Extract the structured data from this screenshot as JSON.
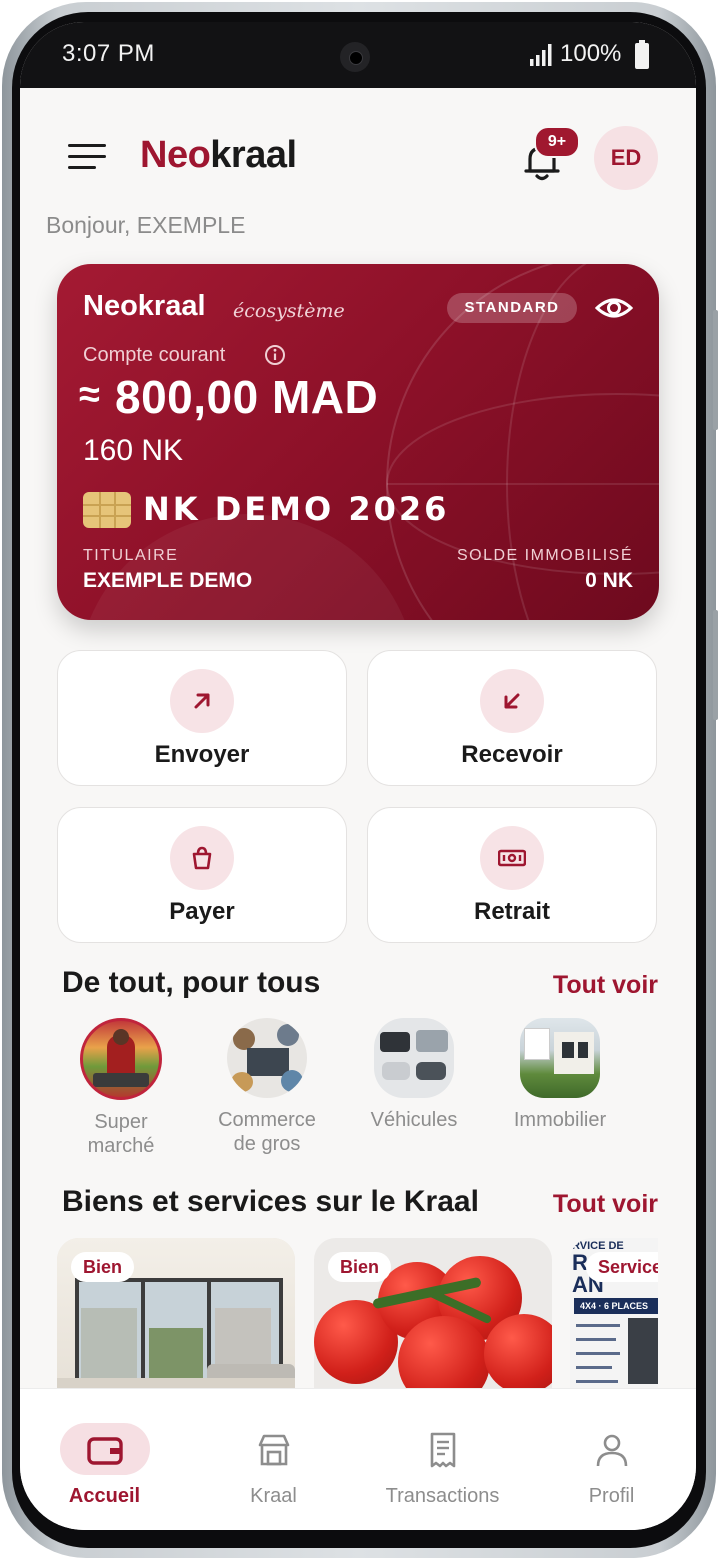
{
  "status_bar": {
    "time": "3:07 PM",
    "battery": "100%"
  },
  "header": {
    "logo_part1": "Neo",
    "logo_part2": "kraal",
    "notification_badge": "9+",
    "avatar_initials": "ED"
  },
  "greeting": "Bonjour, EXEMPLE",
  "card": {
    "brand": "Neokraal",
    "brand_sub": "écosystème",
    "tier": "STANDARD",
    "account_label": "Compte courant",
    "approx_symbol": "≈",
    "balance": "800,00 MAD",
    "nk_balance": "160 NK",
    "card_number": "NK DEMO 2026",
    "holder_label": "TITULAIRE",
    "holder_name": "EXEMPLE DEMO",
    "locked_label": "SOLDE IMMOBILISÉ",
    "locked_value": "0 NK"
  },
  "actions": [
    {
      "label": "Envoyer",
      "icon": "arrow-up-right-icon"
    },
    {
      "label": "Recevoir",
      "icon": "arrow-down-left-icon"
    },
    {
      "label": "Payer",
      "icon": "shopping-bag-icon"
    },
    {
      "label": "Retrait",
      "icon": "banknote-icon"
    }
  ],
  "categories_section": {
    "title": "De tout, pour tous",
    "see_all": "Tout voir",
    "items": [
      {
        "line1": "Super",
        "line2": "marché"
      },
      {
        "line1": "Commerce",
        "line2": "de gros"
      },
      {
        "line1": "Véhicules",
        "line2": ""
      },
      {
        "line1": "Immobilier",
        "line2": ""
      }
    ]
  },
  "listings_section": {
    "title": "Biens et services sur le Kraal",
    "see_all": "Tout voir",
    "items": [
      {
        "tag": "Bien"
      },
      {
        "tag": "Bien"
      },
      {
        "tag": "Service",
        "poster_line1": "RVICE DE",
        "poster_line2": "RA",
        "poster_line3": "AN",
        "poster_line4": "4X4 · 6 PLACES"
      }
    ]
  },
  "bottom_nav": [
    {
      "label": "Accueil",
      "icon": "wallet-icon",
      "active": true
    },
    {
      "label": "Kraal",
      "icon": "store-icon",
      "active": false
    },
    {
      "label": "Transactions",
      "icon": "receipt-icon",
      "active": false
    },
    {
      "label": "Profil",
      "icon": "user-icon",
      "active": false
    }
  ],
  "colors": {
    "brand": "#9e1630",
    "card_dark": "#6e0a1e",
    "background": "#f8f7f6",
    "muted": "#8d8d8d"
  }
}
